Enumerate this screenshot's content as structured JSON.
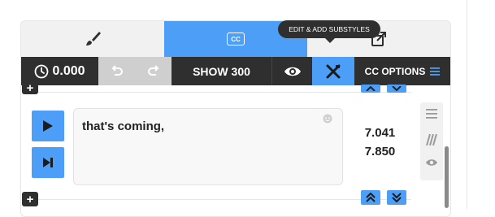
{
  "tabs": {
    "brush": {
      "icon": "brush-icon"
    },
    "cc": {
      "badge_label": "CC",
      "icon": "cc-icon",
      "active": true
    },
    "export": {
      "icon": "export-icon"
    }
  },
  "tooltip": {
    "text": "EDIT & ADD SUBSTYLES"
  },
  "toolbar": {
    "time": "0.000",
    "show_label": "SHOW 300",
    "cc_options_label": "CC OPTIONS"
  },
  "caption": {
    "text": "that's coming,",
    "start": "7.041",
    "end": "7.850"
  },
  "colors": {
    "accent": "#4d9ef7",
    "toolbar_bg": "#2f2f2f",
    "disabled_bg": "#cfcfcf"
  }
}
